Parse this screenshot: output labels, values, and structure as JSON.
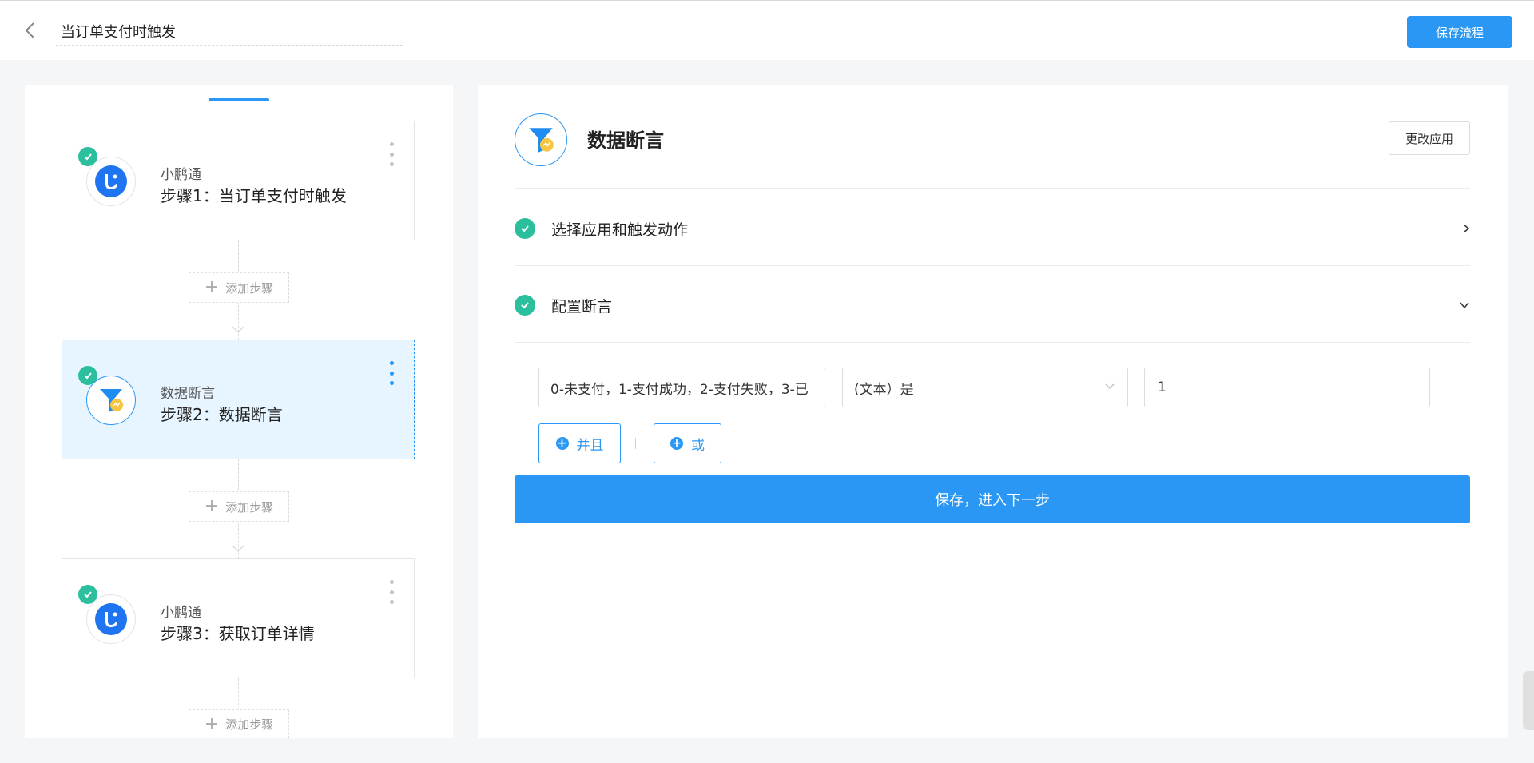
{
  "header": {
    "flow_title": "当订单支付时触发",
    "save_flow_label": "保存流程"
  },
  "steps": [
    {
      "app": "小鹏通",
      "name": "步骤1：当订单支付时触发",
      "icon": "xiaopengtong-icon"
    },
    {
      "app": "数据断言",
      "name": "步骤2：数据断言",
      "icon": "funnel-icon"
    },
    {
      "app": "小鹏通",
      "name": "步骤3：获取订单详情",
      "icon": "xiaopengtong-icon"
    }
  ],
  "add_step_label": "添加步骤",
  "detail": {
    "app_title": "数据断言",
    "change_app_label": "更改应用",
    "sections": [
      {
        "label": "选择应用和触发动作"
      },
      {
        "label": "配置断言"
      }
    ],
    "condition": {
      "field_value": "0-未支付，1-支付成功，2-支付失败，3-已",
      "operator_value": "(文本）是",
      "compare_value": "1"
    },
    "and_label": "并且",
    "or_label": "或",
    "next_label": "保存，进入下一步"
  },
  "colors": {
    "primary": "#2997f3",
    "success": "#2bbf9d",
    "active_bg": "#e6f5ff"
  }
}
